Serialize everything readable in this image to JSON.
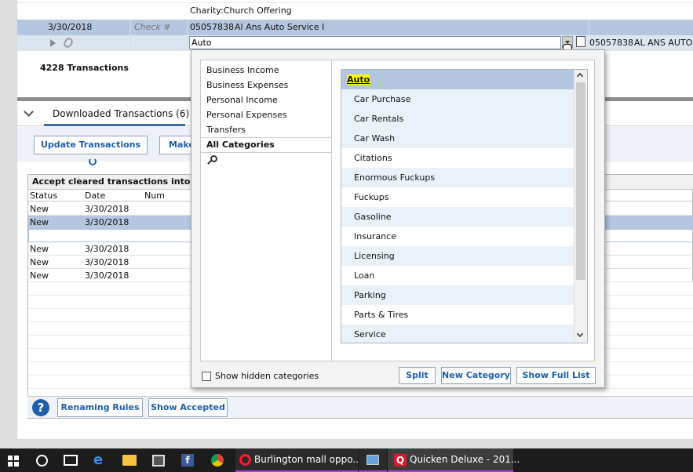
{
  "register": {
    "memo_category": "Charity:Church Offering",
    "date": "3/30/2018",
    "check_placeholder": "Check #",
    "payee_ref": "05057838",
    "payee_name": "Al Ans Auto Service I",
    "category_input": "Auto",
    "right_ref": "05057838",
    "right_name": "AL ANS AUTO S"
  },
  "summary": {
    "transactions_count": "4228 Transactions"
  },
  "downloaded": {
    "tab_label": "Downloaded Transactions (6)",
    "update_button": "Update Transactions",
    "make_button": "Make",
    "accept_header": "Accept cleared transactions into registe",
    "columns": [
      "Status",
      "Date",
      "Num"
    ],
    "rows": [
      {
        "status": "New",
        "date": "3/30/2018"
      },
      {
        "status": "New",
        "date": "3/30/2018"
      },
      {
        "status": "",
        "date": ""
      },
      {
        "status": "New",
        "date": "3/30/2018"
      },
      {
        "status": "New",
        "date": "3/30/2018"
      },
      {
        "status": "New",
        "date": "3/30/2018"
      }
    ],
    "renaming_rules": "Renaming Rules",
    "show_accepted": "Show Accepted"
  },
  "category_picker": {
    "groups": [
      "Business Income",
      "Business Expenses",
      "Personal Income",
      "Personal Expenses",
      "Transfers"
    ],
    "all_categories": "All Categories",
    "items": [
      "Auto",
      "Car Purchase",
      "Car Rentals",
      "Car Wash",
      "Citations",
      "Enormous Fuckups",
      "Fuckups",
      "Gasoline",
      "Insurance",
      "Licensing",
      "Loan",
      "Parking",
      "Parts & Tires",
      "Service"
    ],
    "selected": "Auto",
    "show_hidden_label": "Show hidden categories",
    "split_button": "Split",
    "new_category_button": "New Category",
    "show_full_list_button": "Show Full List"
  },
  "taskbar": {
    "apps": [
      {
        "label": "Burlington mall oppo..."
      },
      {
        "label": "Quicken Deluxe - 201..."
      }
    ]
  },
  "colors": {
    "selected_row": "#b4c6e0",
    "button_text": "#1d5fa8",
    "highlight": "#ffff00"
  }
}
